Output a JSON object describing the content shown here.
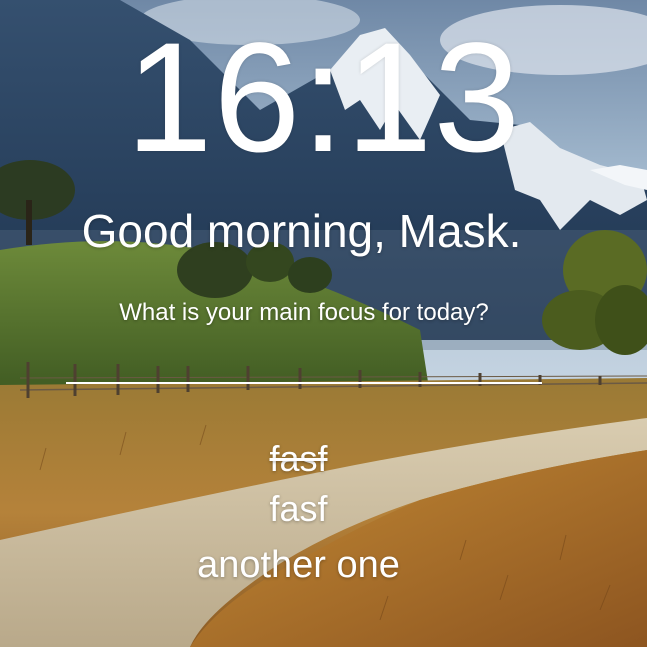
{
  "clock": {
    "time": "16:13"
  },
  "greeting": {
    "text": "Good morning, Mask."
  },
  "focus": {
    "question": "What is your main focus for today?",
    "input_value": "",
    "input_placeholder": ""
  },
  "todos": [
    {
      "text": "fasf",
      "done": true
    },
    {
      "text": "fasf",
      "done": false
    },
    {
      "text": "another one",
      "done": false
    }
  ],
  "colors": {
    "text": "#ffffff",
    "sky": "#9fb6cc",
    "mountain": "#2f4a6b",
    "grass_field": "#b07a2a",
    "road": "#cdbd9e"
  },
  "background": {
    "scene": "mountain-landscape-with-dirt-road"
  }
}
